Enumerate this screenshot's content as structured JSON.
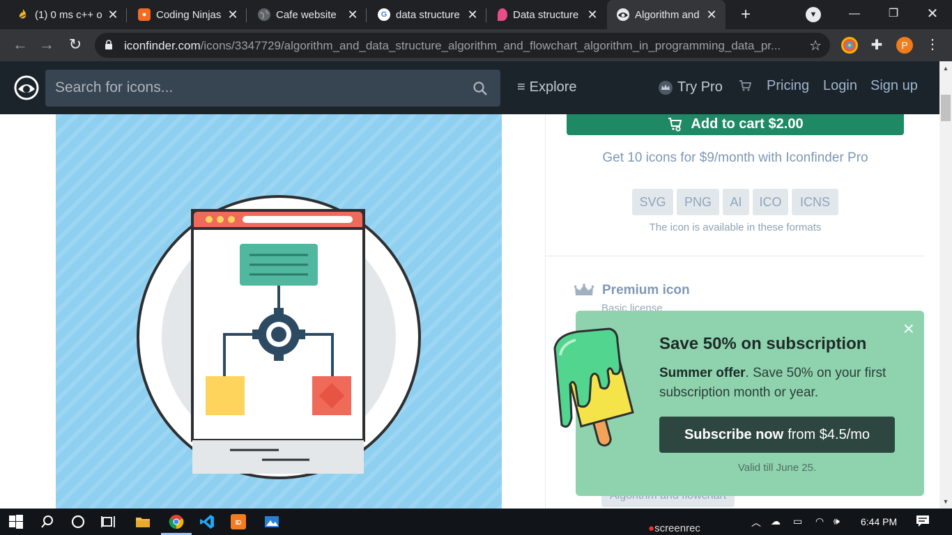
{
  "browser": {
    "tabs": [
      {
        "title": "(1) 0 ms c++ o",
        "favicon": "cp-flame-icon",
        "active": false
      },
      {
        "title": "Coding Ninjas",
        "favicon": "coding-ninjas-icon",
        "active": false
      },
      {
        "title": "Cafe website",
        "favicon": "globe-icon",
        "active": false
      },
      {
        "title": "data structure",
        "favicon": "google-icon",
        "active": false
      },
      {
        "title": "Data structure",
        "favicon": "dribbble-icon",
        "active": false
      },
      {
        "title": "Algorithm and",
        "favicon": "iconfinder-icon",
        "active": true
      }
    ],
    "new_tab": "+",
    "url_domain": "iconfinder.com",
    "url_path": "/icons/3347729/algorithm_and_data_structure_algorithm_and_flowchart_algorithm_in_programming_data_pr...",
    "profile_initial": "P"
  },
  "header": {
    "search_placeholder": "Search for icons...",
    "explore": "Explore",
    "try_pro": "Try Pro",
    "pricing": "Pricing",
    "login": "Login",
    "signup": "Sign up"
  },
  "product": {
    "add_to_cart": "Add to cart $2.00",
    "pro_offer": "Get 10 icons for $9/month with Iconfinder Pro",
    "formats": [
      "SVG",
      "PNG",
      "AI",
      "ICO",
      "ICNS"
    ],
    "formats_note": "The icon is available in these formats",
    "premium_title": "Premium icon",
    "premium_sub": "Basic license",
    "tag": "Algorithm and flowchart"
  },
  "popup": {
    "heading": "Save 50% on subscription",
    "body_bold": "Summer offer",
    "body_rest": ". Save 50% on your first subscription month or year.",
    "cta_bold": "Subscribe now",
    "cta_rest": "from $4.5/mo",
    "valid": "Valid till June 25.",
    "close": "×"
  },
  "taskbar": {
    "time": "6:44 PM",
    "screenrec_dot": "●",
    "screenrec": "screenrec"
  },
  "colors": {
    "cart_green": "#1e8a65",
    "popup_green": "#8fd3ae",
    "preview_blue": "#8fd0f1",
    "header_dark": "#1b232b"
  }
}
